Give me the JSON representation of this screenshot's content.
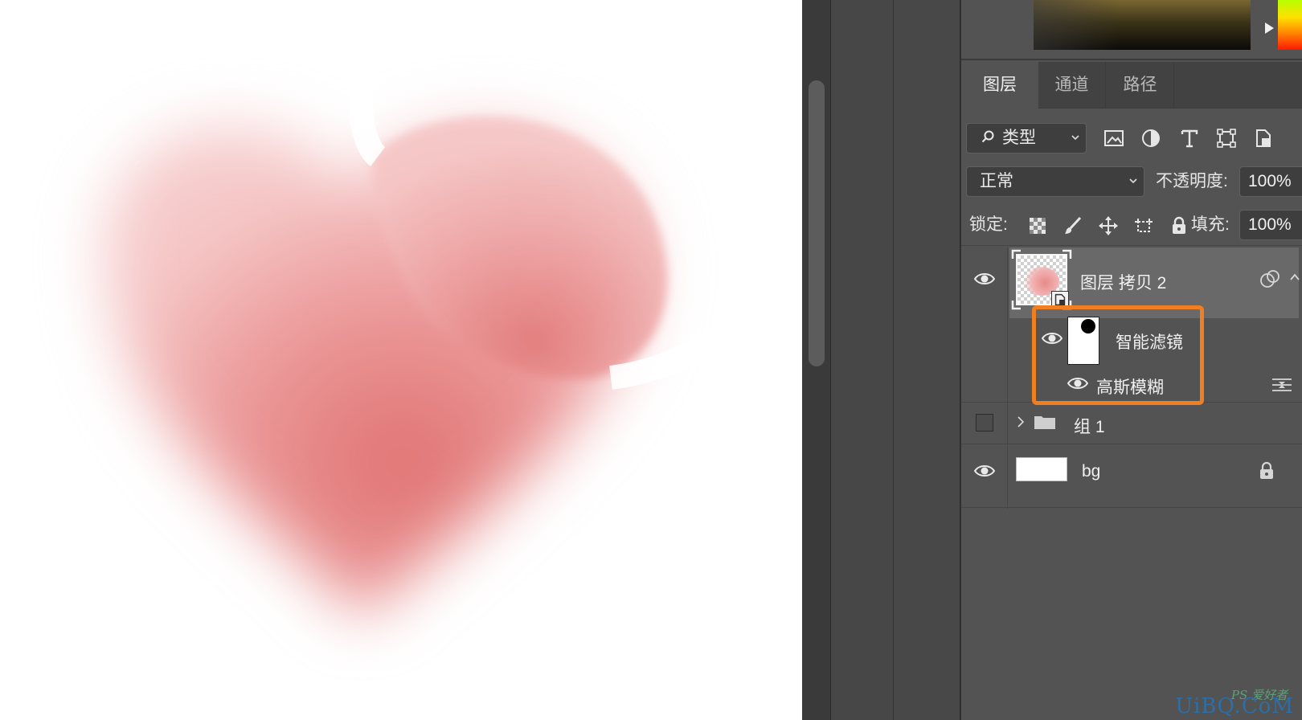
{
  "panel_tabs": {
    "layers": "图层",
    "channels": "通道",
    "paths": "路径"
  },
  "filter": {
    "kind_label": "类型"
  },
  "blend": {
    "mode": "正常",
    "opacity_label": "不透明度:",
    "opacity_value": "100%"
  },
  "lock": {
    "label": "锁定:",
    "fill_label": "填充:",
    "fill_value": "100%"
  },
  "layers": [
    {
      "name": "图层 拷贝 2",
      "visible": true,
      "selected": true,
      "type": "smart-object"
    },
    {
      "name": "智能滤镜",
      "visible": true,
      "type": "smart-filters"
    },
    {
      "name": "高斯模糊",
      "visible": true,
      "type": "filter"
    },
    {
      "name": "组 1",
      "visible": false,
      "type": "group",
      "collapsed": true
    },
    {
      "name": "bg",
      "visible": true,
      "type": "pixel",
      "locked": true
    }
  ],
  "watermark": {
    "top": "PS 爱好者",
    "main": "UiBQ.CoM"
  },
  "colors": {
    "accent_highlight": "#f07f21",
    "heart_pink": "#e47d7d",
    "panel_bg": "#535353"
  }
}
